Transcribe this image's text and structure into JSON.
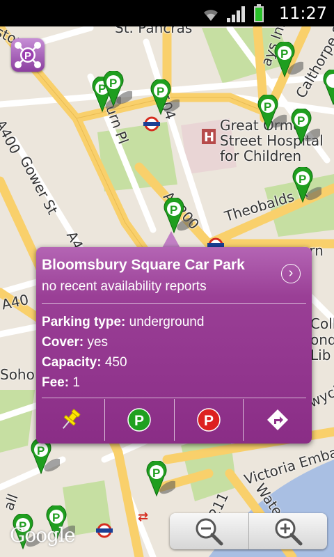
{
  "status_bar": {
    "time": "11:27",
    "icons": [
      "wifi-icon",
      "signal-icon",
      "battery-icon"
    ]
  },
  "map": {
    "labels": {
      "st_pancras": "St. Pancras",
      "gray_inn": "ays Inn Rd",
      "calthorpe": "Calthorpe S",
      "b504": "B504",
      "woburn": "urn Pl",
      "gower": "Gower St",
      "a400a": "A400",
      "a400b": "A40",
      "a40": "A40",
      "great_ormond": "Great Ormo",
      "hospital_line1": "Street Hospital",
      "hospital_line2": "for Children",
      "theobalds": "Theobalds R",
      "a4200": "A4200",
      "born": "orn",
      "coll1": "Coll",
      "coll2": "ondo",
      "coll3": "Lib",
      "soho": "Soho",
      "aldwych": "wych",
      "victoria": "Victoria Emban",
      "water": "Water",
      "num211": "211",
      "all": "all",
      "ston": "ston",
      "google": "Google"
    }
  },
  "popup": {
    "title": "Bloomsbury Square Car Park",
    "subtitle": "no recent availability reports",
    "details": [
      {
        "label": "Parking type:",
        "value": "underground"
      },
      {
        "label": "Cover:",
        "value": "yes"
      },
      {
        "label": "Capacity:",
        "value": "450"
      },
      {
        "label": "Fee:",
        "value": "1"
      }
    ],
    "actions": [
      "pin-icon",
      "parking-green-icon",
      "parking-red-icon",
      "directions-icon"
    ]
  },
  "zoom": {
    "out": "zoom-out-icon",
    "in": "zoom-in-icon"
  },
  "colors": {
    "popup": "#8e3189",
    "road_yellow": "#f9d06b",
    "road_white": "#ffffff",
    "park": "#c6dfa2",
    "water": "#a9bfe3",
    "marker_green": "#1f9e1f"
  }
}
